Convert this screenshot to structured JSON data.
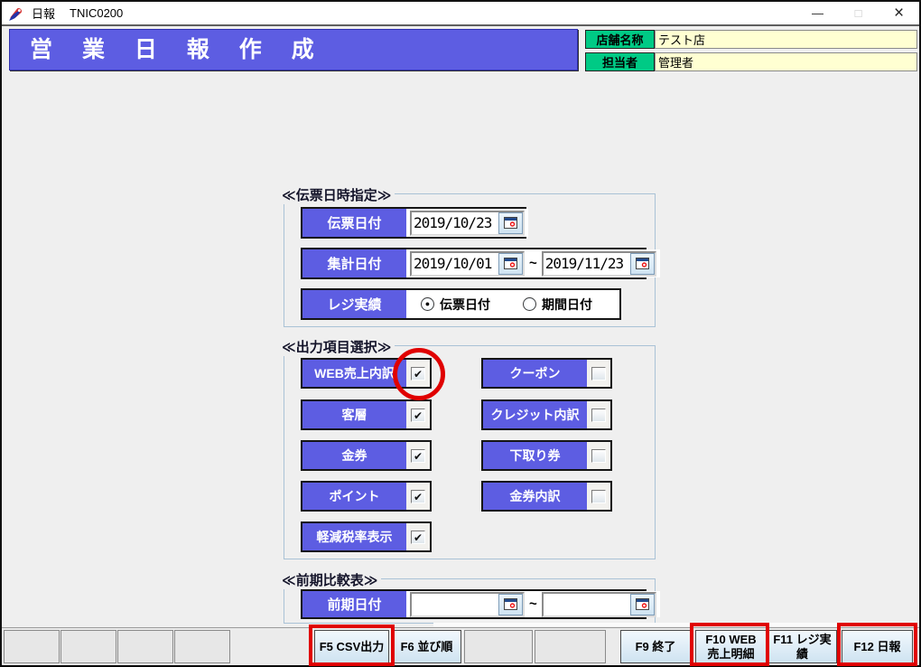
{
  "window": {
    "title": "日報",
    "code": "TNIC0200",
    "controls": {
      "minimize": "—",
      "maximize": "□",
      "close": "×"
    }
  },
  "header": {
    "banner": "営 業 日 報 作 成",
    "store": {
      "label": "店舗名称",
      "value": "テスト店"
    },
    "manager": {
      "label": "担当者",
      "value": "管理者"
    }
  },
  "date_section": {
    "caption": "≪伝票日時指定≫",
    "slip_date": {
      "label": "伝票日付",
      "value": "2019/10/23"
    },
    "total_date": {
      "label": "集計日付",
      "from": "2019/10/01",
      "separator": "~",
      "to": "2019/11/23"
    },
    "register": {
      "label": "レジ実績",
      "options": [
        {
          "label": "伝票日付",
          "selected": true,
          "mark": "●"
        },
        {
          "label": "期間日付",
          "selected": false,
          "mark": ""
        }
      ]
    }
  },
  "output_section": {
    "caption": "≪出力項目選択≫",
    "left_items": [
      {
        "label": "WEB売上内訳",
        "checked": true,
        "mark": "✔"
      },
      {
        "label": "客層",
        "checked": true,
        "mark": "✔"
      },
      {
        "label": "金券",
        "checked": true,
        "mark": "✔"
      },
      {
        "label": "ポイント",
        "checked": true,
        "mark": "✔"
      },
      {
        "label": "軽減税率表示",
        "checked": true,
        "mark": "✔"
      }
    ],
    "right_items": [
      {
        "label": "クーポン",
        "checked": false,
        "mark": ""
      },
      {
        "label": "クレジット内訳",
        "checked": false,
        "mark": ""
      },
      {
        "label": "下取り券",
        "checked": false,
        "mark": ""
      },
      {
        "label": "金券内訳",
        "checked": false,
        "mark": ""
      }
    ]
  },
  "compare_section": {
    "caption": "≪前期比較表≫",
    "row": {
      "label": "前期日付",
      "from": "",
      "separator": "~",
      "to": ""
    }
  },
  "function_bar": {
    "buttons": [
      {
        "label": "",
        "empty": true
      },
      {
        "label": "",
        "empty": true
      },
      {
        "label": "",
        "empty": true
      },
      {
        "label": "",
        "empty": true
      },
      {
        "label": "F5 CSV出力",
        "highlighted": true
      },
      {
        "label": "F6 並び順",
        "highlighted": false
      },
      {
        "label": "",
        "empty": true
      },
      {
        "label": "",
        "empty": true
      },
      {
        "label": "F9 終了",
        "highlighted": false
      },
      {
        "label": "F10 WEB\n売上明細",
        "highlighted": true
      },
      {
        "label": "F11 レジ実績",
        "highlighted": false
      },
      {
        "label": "F12 日報",
        "highlighted": true
      }
    ]
  },
  "annotations": {
    "color": "#e00000",
    "circle_target": "WEB売上内訳 checkbox",
    "box_targets": [
      "F5 CSV出力",
      "F10 WEB売上明細",
      "F12 日報"
    ]
  },
  "colors": {
    "accent_blue": "#5d5de2",
    "accent_green": "#00ca85",
    "field_yellow": "#ffffd2",
    "function_button_blue": "#d9eaf6"
  }
}
